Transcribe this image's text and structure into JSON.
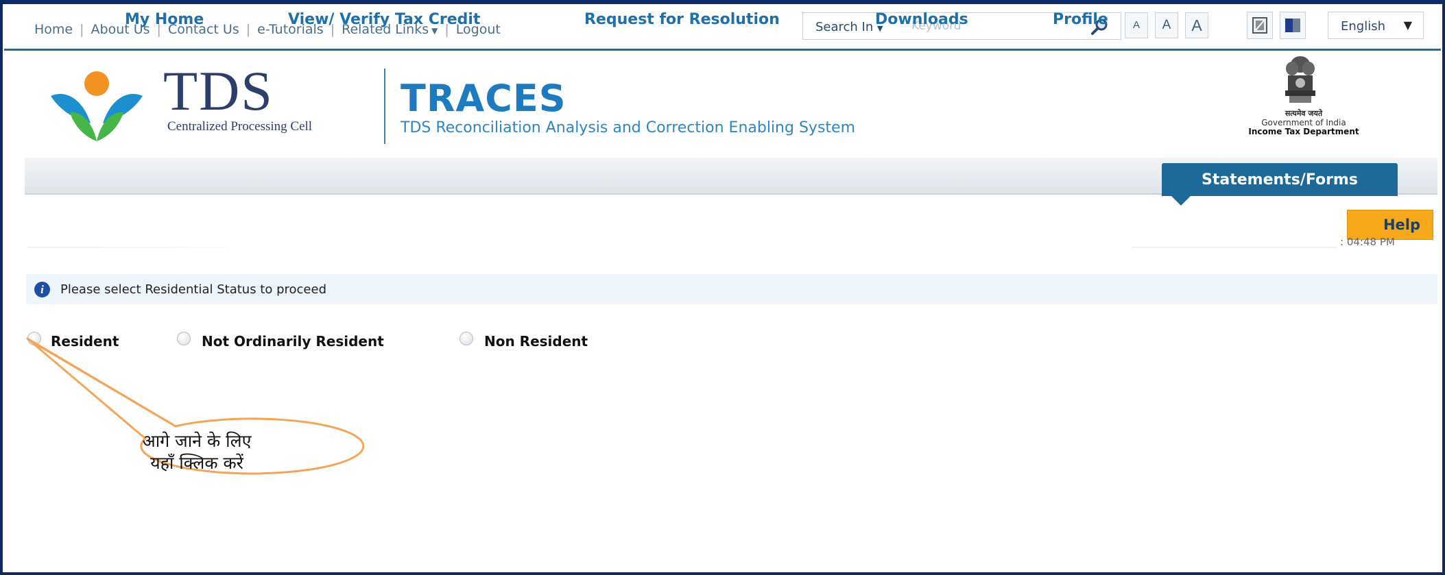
{
  "top_links": {
    "home": "Home",
    "about": "About Us",
    "contact": "Contact Us",
    "tutorials": "e-Tutorials",
    "related": "Related Links",
    "logout": "Logout"
  },
  "search": {
    "label": "Search In",
    "placeholder": "Keyword"
  },
  "font_size_buttons": [
    "A",
    "A",
    "A"
  ],
  "language": {
    "selected": "English"
  },
  "header": {
    "tds_title": "TDS",
    "tds_subtitle": "Centralized Processing Cell",
    "traces_title": "TRACES",
    "traces_subtitle": "TDS Reconciliation Analysis and Correction Enabling System",
    "gov_hindi": "सत्यमेव जयते",
    "gov_line1": "Government of India",
    "gov_line2": "Income Tax Department"
  },
  "nav": {
    "items": [
      "My Home",
      "View/ Verify Tax Credit",
      "Request for Resolution",
      "Downloads",
      "Profile"
    ],
    "active": "Statements/Forms"
  },
  "help_label": "Help",
  "faint_time": ": 04:48 PM",
  "info_message": "Please select Residential Status to proceed",
  "residential_options": [
    "Resident",
    "Not Ordinarily Resident",
    "Non Resident"
  ],
  "callout": {
    "line1": "आगे जाने के लिए",
    "line2": "यहाँ क्लिक करें",
    "color": "#f2a65a"
  },
  "colors": {
    "nav_active": "#1d6a9a",
    "help": "#f7a81b",
    "traces": "#1f7bbf",
    "frame": "#0e2a66"
  }
}
